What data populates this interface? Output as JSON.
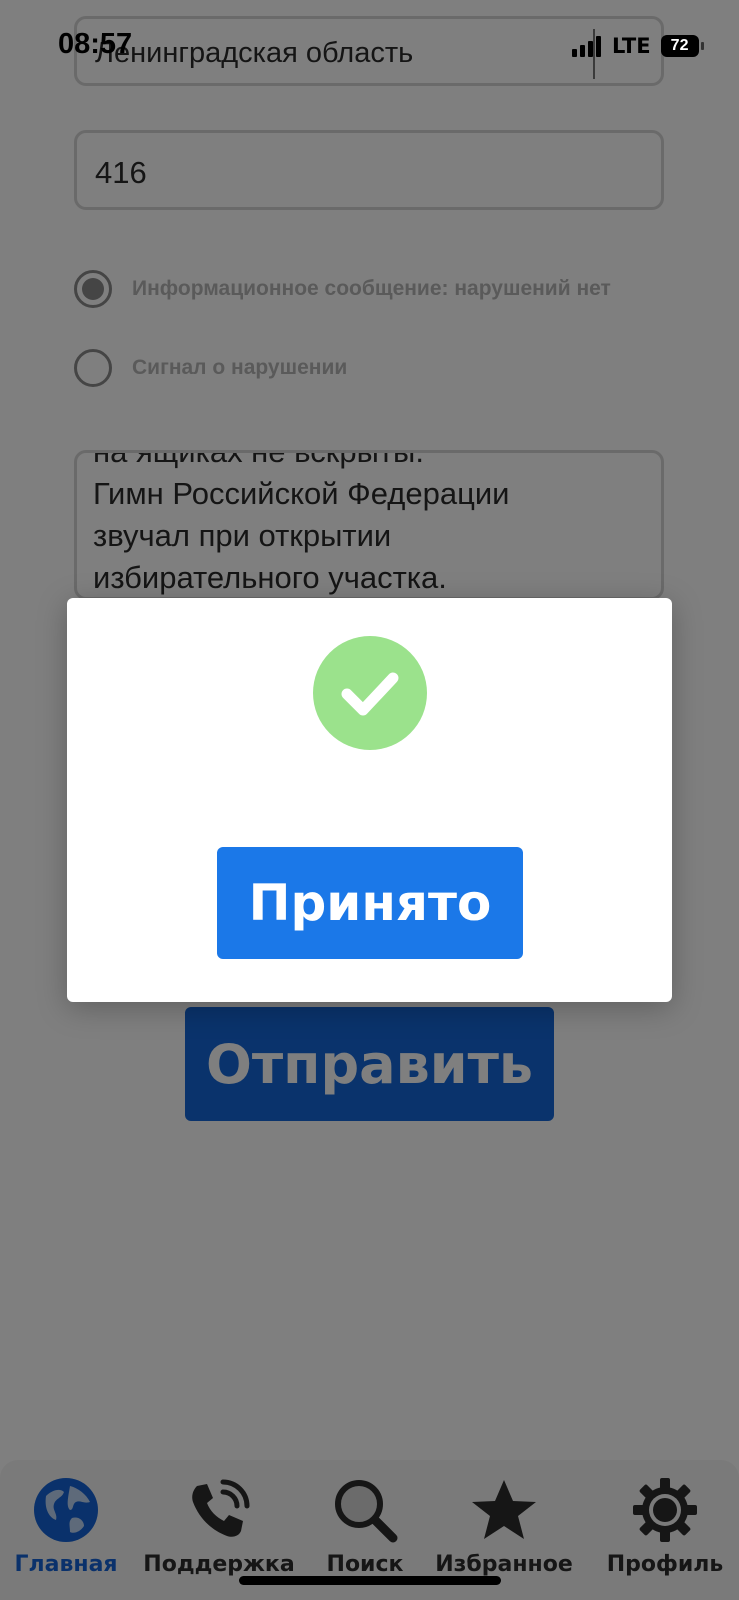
{
  "status_bar": {
    "time": "08:57",
    "network": "LTE",
    "battery": "72"
  },
  "form": {
    "region_value": "Ленинградская область",
    "number_value": "416",
    "report_type": {
      "options": [
        {
          "label": "Информационное сообщение: нарушений нет",
          "selected": true
        },
        {
          "label": "Сигнал о нарушении",
          "selected": false
        }
      ]
    },
    "message_lines": [
      "на ящиках не вскрыты.",
      "Гимн Российской Федерации",
      "звучал при открытии",
      "избирательного участка."
    ],
    "submit_label": "Отправить"
  },
  "modal": {
    "icon": "check-circle-icon",
    "accept_label": "Принято",
    "success_color": "#9be28c"
  },
  "tabbar": {
    "items": [
      {
        "label": "Главная",
        "icon": "globe-icon",
        "active": true
      },
      {
        "label": "Поддержка",
        "icon": "phone-icon",
        "active": false
      },
      {
        "label": "Поиск",
        "icon": "search-icon",
        "active": false
      },
      {
        "label": "Избранное",
        "icon": "star-icon",
        "active": false
      },
      {
        "label": "Профиль",
        "icon": "gear-icon",
        "active": false
      }
    ]
  },
  "colors": {
    "accent": "#1b78e8",
    "active_tab": "#1463d6"
  }
}
